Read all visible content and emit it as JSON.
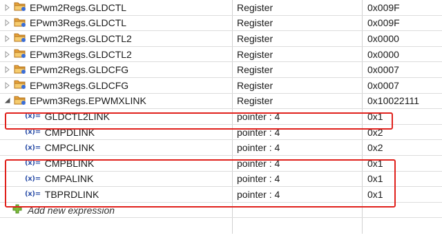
{
  "rows": [
    {
      "expression": "EPwm2Regs.GLDCTL",
      "type": "Register",
      "value": "0x009F",
      "state": "collapsed"
    },
    {
      "expression": "EPwm3Regs.GLDCTL",
      "type": "Register",
      "value": "0x009F",
      "state": "collapsed"
    },
    {
      "expression": "EPwm2Regs.GLDCTL2",
      "type": "Register",
      "value": "0x0000",
      "state": "collapsed"
    },
    {
      "expression": "EPwm3Regs.GLDCTL2",
      "type": "Register",
      "value": "0x0000",
      "state": "collapsed"
    },
    {
      "expression": "EPwm2Regs.GLDCFG",
      "type": "Register",
      "value": "0x0007",
      "state": "collapsed"
    },
    {
      "expression": "EPwm3Regs.GLDCFG",
      "type": "Register",
      "value": "0x0007",
      "state": "collapsed"
    },
    {
      "expression": "EPwm3Regs.EPWMXLINK",
      "type": "Register",
      "value": "0x10022111",
      "state": "expanded"
    }
  ],
  "children": [
    {
      "icon_text": "(x)=",
      "expression": "GLDCTL2LINK",
      "type": "pointer : 4",
      "value": "0x1"
    },
    {
      "icon_text": "(x)=",
      "expression": "CMPDLINK",
      "type": "pointer : 4",
      "value": "0x2"
    },
    {
      "icon_text": "(x)=",
      "expression": "CMPCLINK",
      "type": "pointer : 4",
      "value": "0x2"
    },
    {
      "icon_text": "(x)=",
      "expression": "CMPBLINK",
      "type": "pointer : 4",
      "value": "0x1"
    },
    {
      "icon_text": "(x)=",
      "expression": "CMPALINK",
      "type": "pointer : 4",
      "value": "0x1"
    },
    {
      "icon_text": "(x)=",
      "expression": "TBPRDLINK",
      "type": "pointer : 4",
      "value": "0x1"
    }
  ],
  "add_row": {
    "label": "Add new expression",
    "icon": "add-plus-icon"
  },
  "colors": {
    "highlight": "#e0201b",
    "var_icon": "#2c4fa8",
    "folder": "#e8a33c"
  }
}
